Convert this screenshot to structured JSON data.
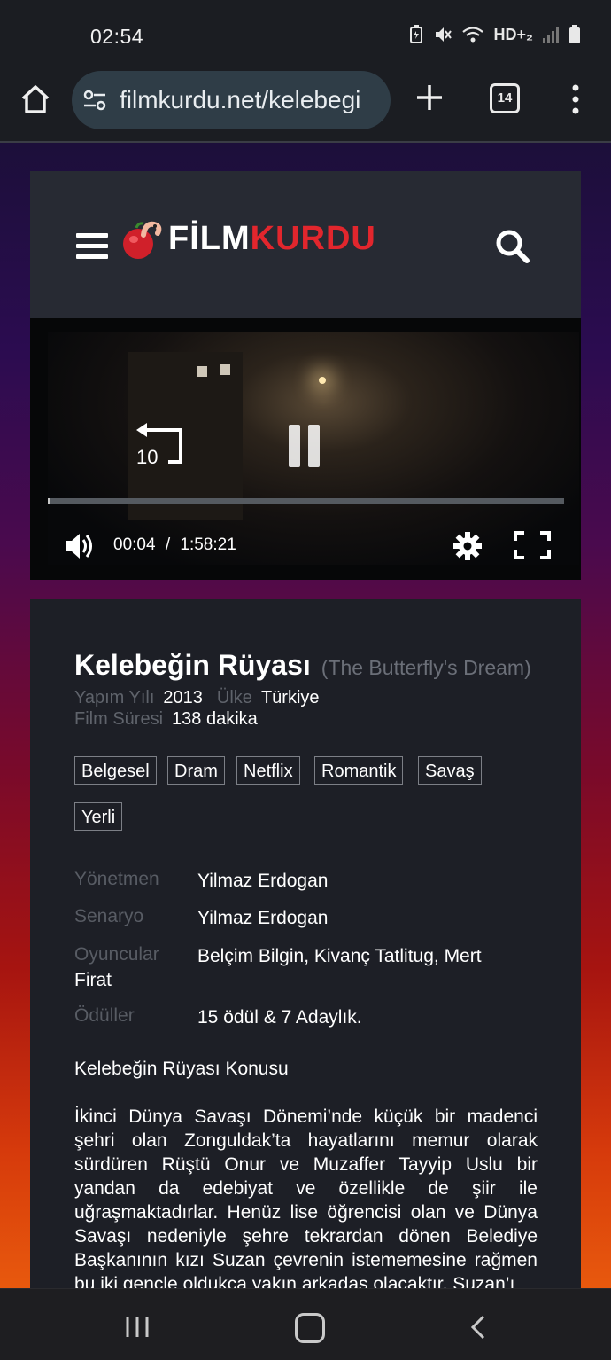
{
  "status_bar": {
    "time": "02:54",
    "hd_label": "HD+₂"
  },
  "browser": {
    "url": "filmkurdu.net/kelebegi",
    "tab_count": "14"
  },
  "site": {
    "logo_film": "FİLM",
    "logo_kurdu": "KURDU"
  },
  "player": {
    "current_time": "00:04",
    "separator": "/",
    "duration": "1:58:21",
    "replay_seconds": "10",
    "progress": 0.0008
  },
  "movie": {
    "title": "Kelebeğin Rüyası",
    "original_title": "(The Butterfly's Dream)",
    "year_label": "Yapım Yılı",
    "year": "2013",
    "country_label": "Ülke",
    "country": "Türkiye",
    "duration_label": "Film Süresi",
    "duration": "138 dakika",
    "genres": [
      "Belgesel",
      "Dram",
      "Netflix",
      "Romantik",
      "Savaş",
      "Yerli"
    ],
    "director_label": "Yönetmen",
    "director": "Yilmaz Erdogan",
    "writer_label": "Senaryo",
    "writer": "Yilmaz Erdogan",
    "cast_label": "Oyuncular",
    "cast": "Belçim Bilgin, Kivanç Tatlitug, Mert",
    "cast_wrap": "Firat",
    "awards_label": "Ödüller",
    "awards": "15 ödül & 7 Adaylık.",
    "plot_heading": "Kelebeğin Rüyası Konusu",
    "plot": "İkinci Dünya Savaşı Dönemi’nde küçük bir madenci şehri olan Zonguldak’ta hayatlarını memur olarak sürdüren Rüştü Onur ve Muzaffer Tayyip Uslu bir yandan da edebiyat ve özellikle de şiir ile uğraşmaktadırlar. Henüz lise öğrencisi olan ve Dünya Savaşı nedeniyle şehre tekrardan dönen Belediye Başkanının kızı Suzan çevrenin istememesine rağmen bu iki gençle oldukça yakın arkadaş olacaktır. Suzan’ı"
  },
  "colors": {
    "accent_red": "#e2262d",
    "url_bar": "#2f3d47",
    "card": "#272a33"
  }
}
